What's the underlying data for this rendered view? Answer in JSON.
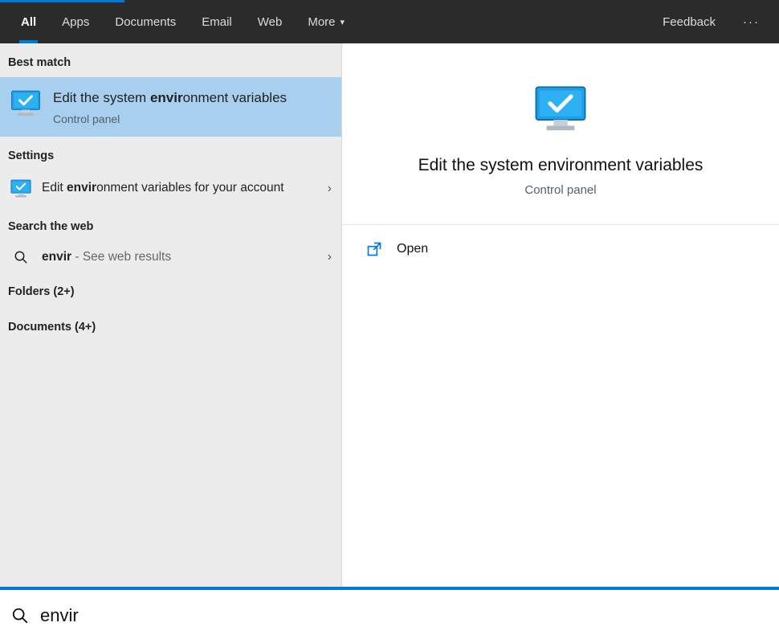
{
  "tabs": {
    "all": "All",
    "apps": "Apps",
    "documents": "Documents",
    "email": "Email",
    "web": "Web",
    "more": "More"
  },
  "feedback": "Feedback",
  "left": {
    "best_match_label": "Best match",
    "best_match": {
      "title_pre": "Edit the system ",
      "title_bold": "envir",
      "title_post": "onment variables",
      "sub": "Control panel"
    },
    "settings_label": "Settings",
    "settings_item": {
      "pre": "Edit ",
      "bold": "envir",
      "post": "onment variables for your account"
    },
    "web_label": "Search the web",
    "web_item": {
      "bold": "envir",
      "suffix": " - See web results"
    },
    "folders_label": "Folders (2+)",
    "documents_label": "Documents (4+)"
  },
  "preview": {
    "title": "Edit the system environment variables",
    "sub": "Control panel",
    "open": "Open"
  },
  "search": {
    "value": "envir"
  }
}
